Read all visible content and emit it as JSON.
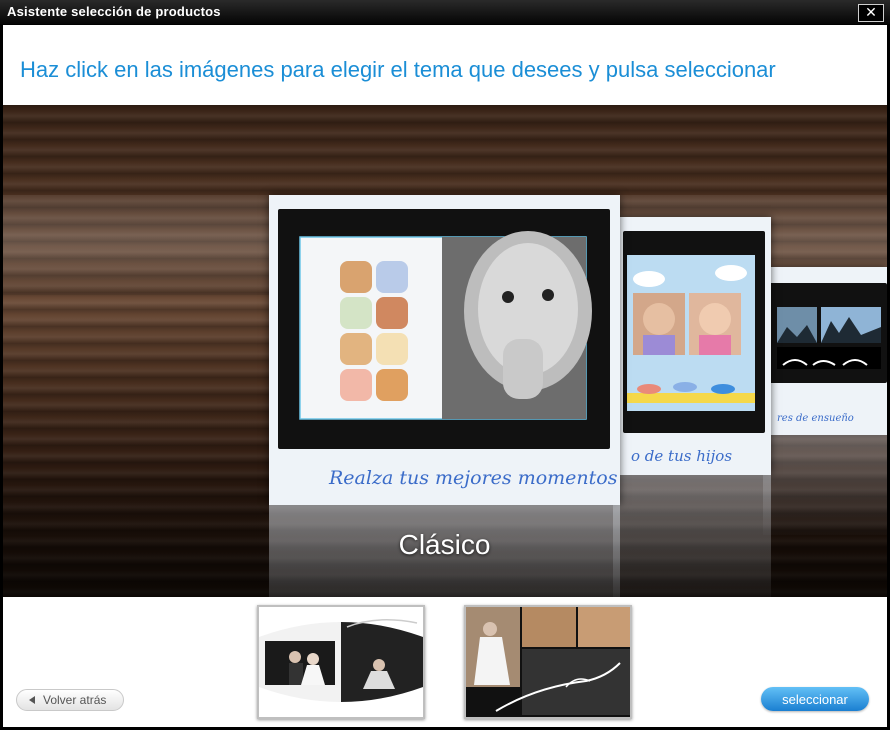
{
  "window": {
    "title": "Asistente selección de productos",
    "close_symbol": "✕"
  },
  "instruction": "Haz click en las imágenes para elegir el tema que desees y pulsa seleccionar",
  "carousel": {
    "selected_label": "Clásico",
    "cards": [
      {
        "caption": "Realza tus mejores momentos"
      },
      {
        "caption": "o de tus hijos"
      },
      {
        "caption": "res de ensueño"
      }
    ]
  },
  "footer": {
    "back_label": "Volver atrás",
    "select_label": "seleccionar"
  },
  "colors": {
    "instruction": "#1b8ed6",
    "select_button": "#1a7fd1",
    "caption": "#3b6cc9"
  }
}
